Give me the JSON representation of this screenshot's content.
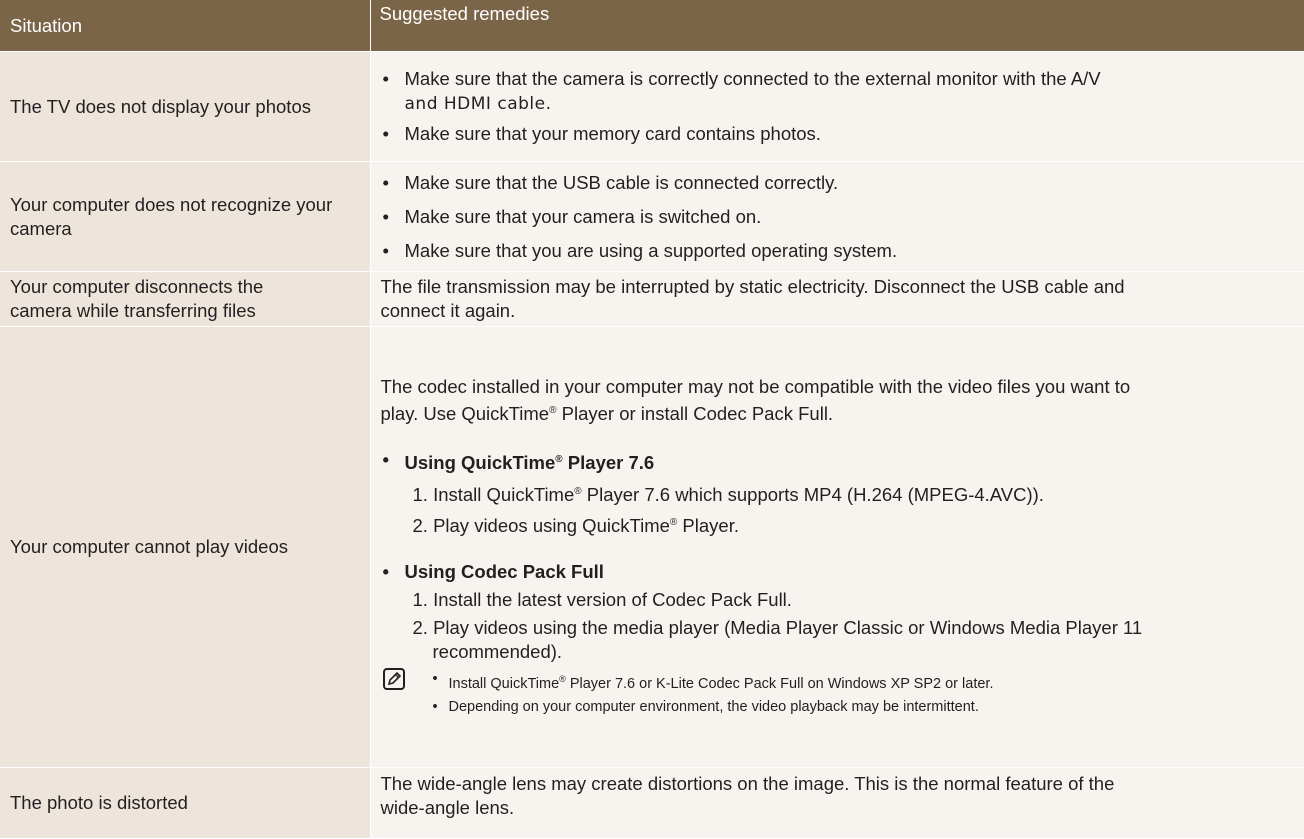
{
  "header": {
    "col1": "Situation",
    "col2": "Suggested remedies"
  },
  "rows": [
    {
      "situation": "The TV does not display your photos",
      "remedies": [
        "Make sure that the camera is correctly connected to the external monitor with the A/V",
        "and HDMI cable.",
        "Make sure that your memory card contains photos."
      ]
    },
    {
      "situation": "Your computer does not recognize your camera",
      "remedies": [
        "Make sure that the USB cable is connected correctly.",
        "Make sure that your camera is switched on.",
        "Make sure that you are using a supported operating system."
      ]
    },
    {
      "situation_line1": "Your computer disconnects the",
      "situation_line2": "camera while transferring files",
      "remedy_line1": "The file transmission may be interrupted by static electricity. Disconnect the USB cable and",
      "remedy_line2": "connect it again."
    },
    {
      "situation": "Your computer cannot play videos",
      "intro_line1": "The codec installed in your computer may not be compatible with the video files you want to",
      "intro_line2_a": "play. Use QuickTime",
      "intro_line2_b": " Player or install Codec Pack Full.",
      "reg": "®",
      "qt_heading_a": "Using QuickTime",
      "qt_heading_b": " Player 7.6",
      "qt_step1_a": "1. Install QuickTime",
      "qt_step1_b": " Player 7.6 which supports MP4 (H.264 (MPEG-4.AVC)).",
      "qt_step2_a": "2. Play videos using QuickTime",
      "qt_step2_b": " Player.",
      "cp_heading": "Using Codec Pack Full",
      "cp_step1": "1. Install the latest version of Codec Pack Full.",
      "cp_step2_line1": "2. Play videos using the media player (Media Player Classic or Windows Media Player 11",
      "cp_step2_line2": "recommended).",
      "note1_a": "Install QuickTime",
      "note1_b": " Player 7.6 or K-Lite Codec Pack Full on Windows XP SP2 or later.",
      "note2": "Depending on your computer environment, the video playback may be intermittent."
    },
    {
      "situation": "The photo is distorted",
      "remedy_line1": "The wide-angle lens may create distortions on the image. This is the normal feature of the",
      "remedy_line2": "wide-angle lens."
    }
  ],
  "icons": {
    "note": "note-pencil-icon"
  },
  "colors": {
    "header_bg": "#7a6548",
    "situation_bg": "#ede5dc",
    "remedy_bg": "#f7f4f0"
  }
}
